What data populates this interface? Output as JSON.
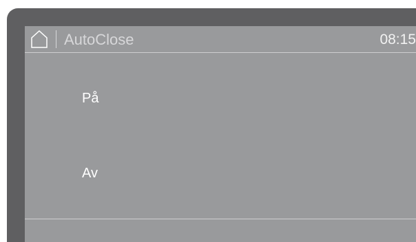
{
  "header": {
    "home_icon": "home-icon",
    "title": "AutoClose",
    "time": "08:15"
  },
  "options": [
    {
      "label": "På"
    },
    {
      "label": "Av"
    }
  ],
  "colors": {
    "bezel": "#5f5f61",
    "screen": "#999a9c",
    "text": "#ffffff",
    "divider": "#cfcfd1"
  }
}
